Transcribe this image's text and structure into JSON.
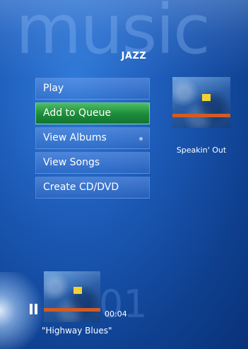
{
  "header": {
    "watermark": "music",
    "category": "JAZZ"
  },
  "menu": {
    "items": [
      {
        "label": "Play",
        "active": false,
        "has_indicator": false
      },
      {
        "label": "Add to Queue",
        "active": true,
        "has_indicator": false
      },
      {
        "label": "View Albums",
        "active": false,
        "has_indicator": true
      },
      {
        "label": "View Songs",
        "active": false,
        "has_indicator": false
      },
      {
        "label": "Create CD/DVD",
        "active": false,
        "has_indicator": false
      }
    ]
  },
  "featured_album": {
    "title": "Speakin' Out",
    "art_icon": "album-cover-image"
  },
  "now_playing": {
    "state_icon": "pause-icon",
    "track_number": "01",
    "elapsed": "00:04",
    "track_title": "\"Highway Blues\""
  },
  "colors": {
    "background": "#1b58b4",
    "active_item": "#2a9a47",
    "album_band": "#d35b22",
    "album_strip": "#f2d230"
  }
}
